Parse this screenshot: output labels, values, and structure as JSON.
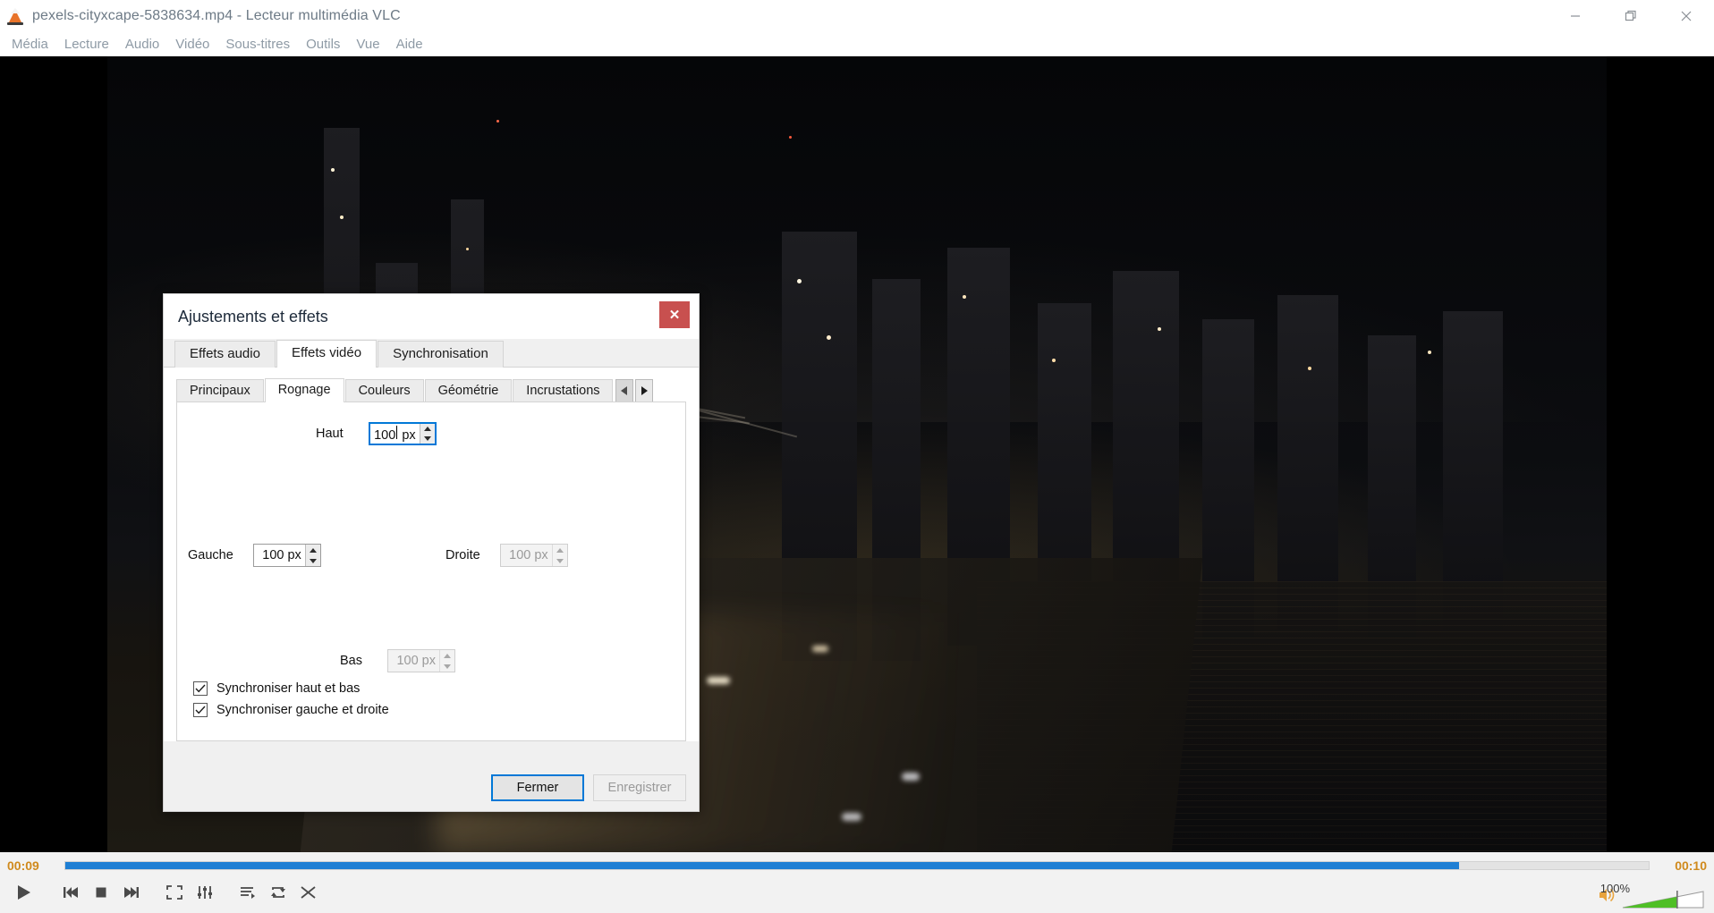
{
  "window": {
    "title": "pexels-cityxcape-5838634.mp4 - Lecteur multimédia VLC",
    "logo_icon": "vlc-cone-icon",
    "controls": [
      {
        "name": "minimize",
        "icon": "minimize-icon"
      },
      {
        "name": "restore",
        "icon": "restore-icon"
      },
      {
        "name": "close",
        "icon": "close-icon"
      }
    ]
  },
  "menubar": {
    "items": [
      {
        "label": "Média"
      },
      {
        "label": "Lecture"
      },
      {
        "label": "Audio"
      },
      {
        "label": "Vidéo"
      },
      {
        "label": "Sous-titres"
      },
      {
        "label": "Outils"
      },
      {
        "label": "Vue"
      },
      {
        "label": "Aide"
      }
    ]
  },
  "dialog": {
    "title": "Ajustements et effets",
    "close_label": "✕",
    "close_icon": "close-icon",
    "main_tabs": [
      {
        "label": "Effets audio",
        "active": false
      },
      {
        "label": "Effets vidéo",
        "active": true
      },
      {
        "label": "Synchronisation",
        "active": false
      }
    ],
    "sub_tabs": [
      {
        "label": "Principaux",
        "active": false
      },
      {
        "label": "Rognage",
        "active": true
      },
      {
        "label": "Couleurs",
        "active": false
      },
      {
        "label": "Géométrie",
        "active": false
      },
      {
        "label": "Incrustations",
        "active": false
      }
    ],
    "scroll_left_icon": "chevron-left-icon",
    "scroll_right_icon": "chevron-right-icon",
    "crop": {
      "top": {
        "label": "Haut",
        "value": "100 px",
        "focused": true,
        "disabled": false
      },
      "left": {
        "label": "Gauche",
        "value": "100 px",
        "focused": false,
        "disabled": false
      },
      "right": {
        "label": "Droite",
        "value": "100 px",
        "focused": false,
        "disabled": true
      },
      "bottom": {
        "label": "Bas",
        "value": "100 px",
        "focused": false,
        "disabled": true
      }
    },
    "checkboxes": [
      {
        "label": "Synchroniser haut et bas",
        "checked": true
      },
      {
        "label": "Synchroniser gauche et droite",
        "checked": true
      }
    ],
    "buttons": {
      "close": {
        "label": "Fermer",
        "focused": true,
        "disabled": false
      },
      "save": {
        "label": "Enregistrer",
        "focused": false,
        "disabled": true
      }
    }
  },
  "player": {
    "elapsed": "00:09",
    "total": "00:10",
    "progress_percent": 88,
    "volume_label": "100%",
    "volume_percent": 100,
    "controls": [
      {
        "name": "play-button",
        "icon": "play-icon"
      },
      {
        "name": "previous-button",
        "icon": "previous-icon"
      },
      {
        "name": "stop-button",
        "icon": "stop-icon"
      },
      {
        "name": "next-button",
        "icon": "next-icon"
      },
      {
        "name": "fullscreen-button",
        "icon": "fullscreen-icon"
      },
      {
        "name": "extended-settings-button",
        "icon": "equalizer-icon"
      },
      {
        "name": "playlist-button",
        "icon": "playlist-icon"
      },
      {
        "name": "loop-button",
        "icon": "loop-icon"
      },
      {
        "name": "random-button",
        "icon": "shuffle-icon"
      }
    ],
    "speaker_icon": "speaker-icon"
  },
  "colors": {
    "accent_blue": "#0078d7",
    "seek_blue": "#1f7fd4",
    "volume_green": "#4fbf26",
    "time_orange": "#d08a1d",
    "dialog_close_red": "#c8504f"
  }
}
